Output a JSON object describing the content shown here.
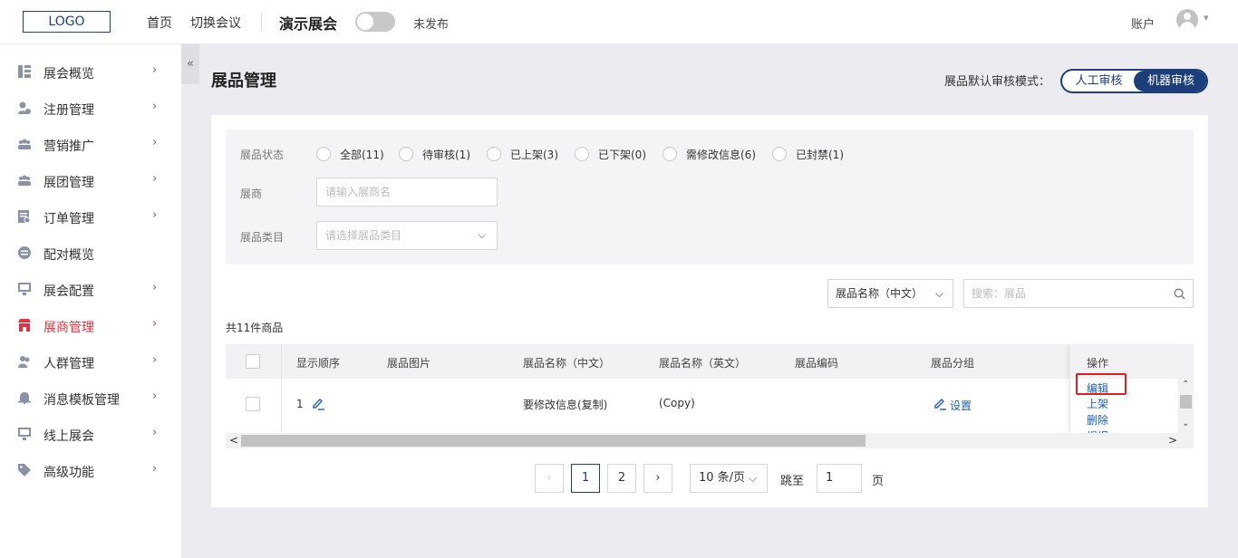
{
  "header": {
    "logo": "LOGO",
    "nav": [
      "首页",
      "切换会议"
    ],
    "expo_title": "演示展会",
    "publish_status": "未发布",
    "account": "账户"
  },
  "sidebar": {
    "collapse": "«",
    "items": [
      {
        "label": "展会概览",
        "icon": "dashboard-icon",
        "arrow": true
      },
      {
        "label": "注册管理",
        "icon": "user-register-icon",
        "arrow": true
      },
      {
        "label": "营销推广",
        "icon": "group-icon",
        "arrow": true
      },
      {
        "label": "展团管理",
        "icon": "group-icon",
        "arrow": true
      },
      {
        "label": "订单管理",
        "icon": "order-icon",
        "arrow": true
      },
      {
        "label": "配对概览",
        "icon": "match-icon",
        "arrow": false
      },
      {
        "label": "展会配置",
        "icon": "monitor-icon",
        "arrow": true
      },
      {
        "label": "展商管理",
        "icon": "store-icon",
        "arrow": true,
        "active": true
      },
      {
        "label": "人群管理",
        "icon": "people-icon",
        "arrow": true
      },
      {
        "label": "消息模板管理",
        "icon": "bell-icon",
        "arrow": true
      },
      {
        "label": "线上展会",
        "icon": "monitor-icon",
        "arrow": true
      },
      {
        "label": "高级功能",
        "icon": "tag-icon",
        "arrow": true
      }
    ],
    "arrow_glyph": "›"
  },
  "page": {
    "title": "展品管理",
    "review_mode_label": "展品默认审核模式：",
    "review_modes": [
      "人工审核",
      "机器审核"
    ],
    "selected_review_mode": "机器审核"
  },
  "filters": {
    "status_label": "展品状态",
    "statuses": [
      "全部(11)",
      "待审核(1)",
      "已上架(3)",
      "已下架(0)",
      "需修改信息(6)",
      "已封禁(1)"
    ],
    "exhibitor_label": "展商",
    "exhibitor_placeholder": "请输入展商名",
    "category_label": "展品类目",
    "category_placeholder": "请选择展品类目"
  },
  "toolbar": {
    "sort_field": "展品名称（中文）",
    "search_placeholder": "搜索：展品"
  },
  "count_text": "共11件商品",
  "table": {
    "columns": [
      "显示顺序",
      "展品图片",
      "展品名称（中文）",
      "展品名称（英文）",
      "展品编码",
      "展品分组",
      "操作"
    ],
    "rows": [
      {
        "order": "1",
        "name_cn": "要修改信息(复制)",
        "name_en": "(Copy)",
        "group_action": "设置",
        "actions": [
          "编辑",
          "上架",
          "删除",
          "提报"
        ]
      }
    ]
  },
  "pagination": {
    "prev": "‹",
    "pages": [
      "1",
      "2"
    ],
    "current": "1",
    "next": "›",
    "page_size": "10 条/页",
    "jump_label": "跳至",
    "jump_value": "1",
    "page_suffix": "页"
  },
  "colors": {
    "brand": "#1c3f7a",
    "active_menu": "#e0343e",
    "link": "#1c5fb0",
    "highlight_box": "#e02020"
  }
}
